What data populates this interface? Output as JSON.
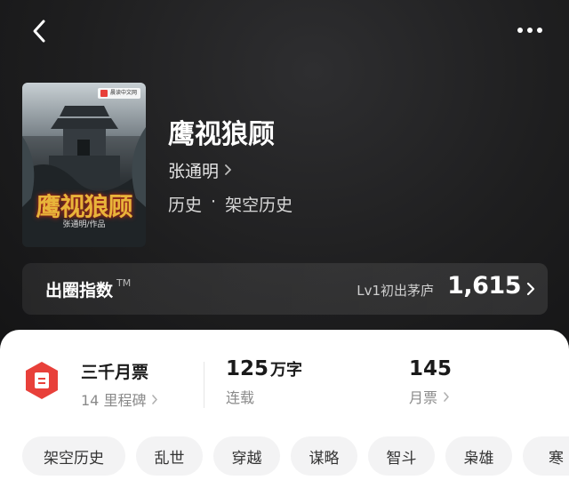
{
  "header": {
    "back_icon": "chevron-left-icon",
    "more_icon": "more-dots-icon"
  },
  "book": {
    "cover": {
      "badge": "晨读中文网",
      "title": "鹰视狼顾",
      "author_line": "张通明/作品"
    },
    "title": "鹰视狼顾",
    "author": "张通明",
    "genre": [
      "历史",
      "·",
      "架空历史"
    ]
  },
  "score": {
    "label": "出圈指数",
    "tm": "TM",
    "level": "Lv1初出茅庐",
    "value": "1,615"
  },
  "stats": {
    "ticket_name": "三千月票",
    "ticket_sub": "14 里程碑",
    "words_num": "125",
    "words_unit": "万字",
    "words_label": "连载",
    "votes_num": "145",
    "votes_label": "月票"
  },
  "tags": [
    "架空历史",
    "乱世",
    "穿越",
    "谋略",
    "智斗",
    "枭雄",
    "寒"
  ],
  "colors": {
    "accent_red": "#e8403a",
    "dark_bg": "#1b1b1c",
    "sheet_bg": "#ffffff",
    "tag_bg": "#f3f3f4"
  }
}
